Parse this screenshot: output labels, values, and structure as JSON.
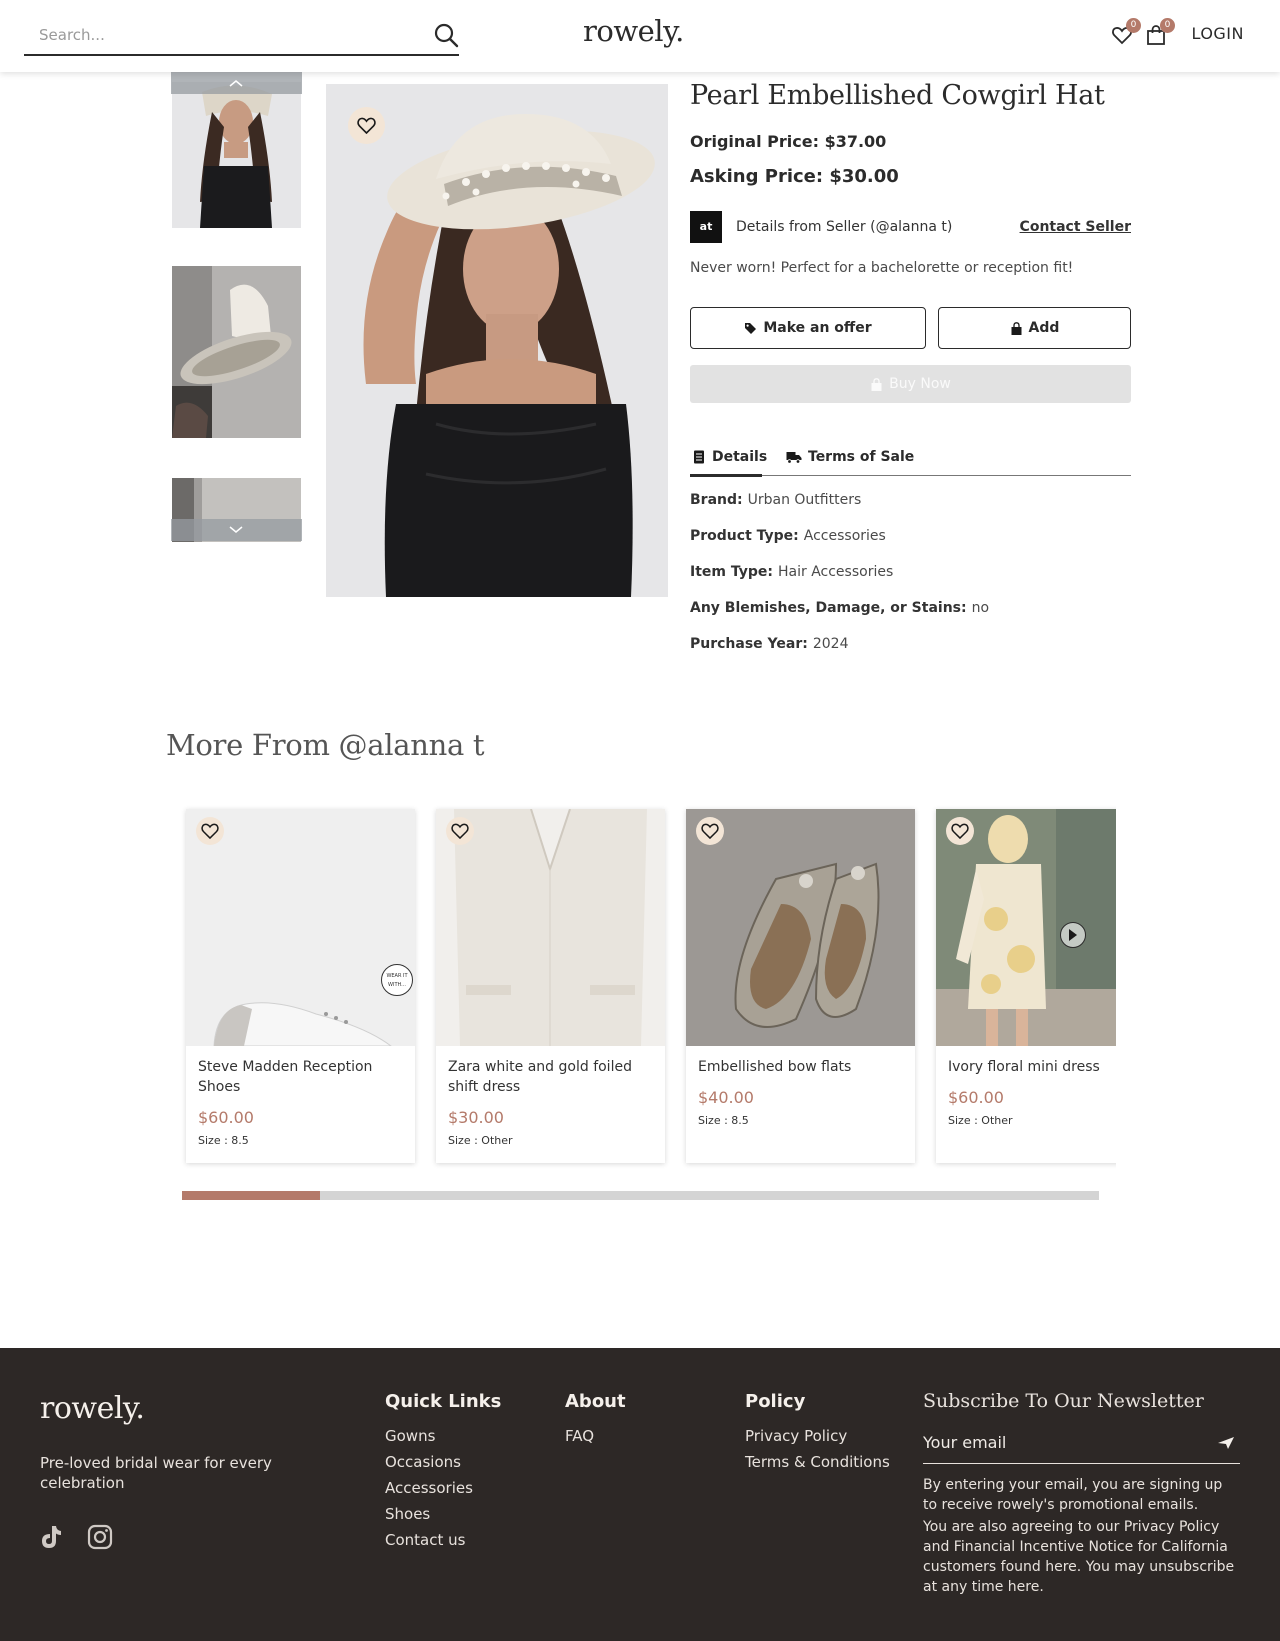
{
  "header": {
    "search_placeholder": "Search...",
    "logo": "rowely.",
    "wishlist_count": "0",
    "cart_count": "0",
    "login_label": "LOGIN"
  },
  "product": {
    "title": "Pearl Embellished Cowgirl Hat",
    "original_price": "Original Price: $37.00",
    "asking_price": "Asking Price: $30.00",
    "seller_initials": "at",
    "seller_label": "Details from Seller (@alanna t)",
    "contact_label": "Contact Seller",
    "description": "Never worn! Perfect for a bachelorette or reception fit!",
    "offer_label": "Make an offer",
    "add_label": "Add",
    "buy_label": "Buy Now",
    "tabs": [
      {
        "label": "Details",
        "icon": "document-icon"
      },
      {
        "label": "Terms of Sale",
        "icon": "truck-icon"
      }
    ],
    "specs": [
      {
        "key": "Brand:",
        "value": "Urban Outfitters"
      },
      {
        "key": "Product Type:",
        "value": "Accessories"
      },
      {
        "key": "Item Type:",
        "value": "Hair Accessories"
      },
      {
        "key": "Any Blemishes, Damage, or Stains:",
        "value": "no"
      },
      {
        "key": "Purchase Year:",
        "value": "2024"
      }
    ]
  },
  "more": {
    "title": "More From @alanna t",
    "badge_text": "WEAR IT WITH...",
    "cards": [
      {
        "name": "Steve Madden Reception Shoes",
        "price": "$60.00",
        "size": "Size : 8.5"
      },
      {
        "name": "Zara white and gold foiled shift dress",
        "price": "$30.00",
        "size": "Size : Other"
      },
      {
        "name": "Embellished bow flats",
        "price": "$40.00",
        "size": "Size : 8.5"
      },
      {
        "name": "Ivory floral mini dress",
        "price": "$60.00",
        "size": "Size : Other"
      }
    ],
    "scroll_progress": 0.15
  },
  "footer": {
    "logo": "rowely.",
    "tagline": "Pre-loved bridal wear for every celebration",
    "quick_links": {
      "title": "Quick Links",
      "items": [
        "Gowns",
        "Occasions",
        "Accessories",
        "Shoes",
        "Contact us"
      ]
    },
    "about": {
      "title": "About",
      "items": [
        "FAQ"
      ]
    },
    "policy": {
      "title": "Policy",
      "items": [
        "Privacy Policy",
        "Terms & Conditions"
      ]
    },
    "newsletter": {
      "title": "Subscribe To Our Newsletter",
      "email_placeholder": "Your email",
      "legal_1": "By entering your email, you are signing up to receive rowely's promotional emails.",
      "legal_2": "You are also agreeing to our Privacy Policy and Financial Incentive Notice for California customers found here. You may unsubscribe at any time here."
    }
  },
  "colors": {
    "accent": "#b47a6a",
    "footer_bg": "#2d2826",
    "fav_bg": "#f3e5d6"
  }
}
